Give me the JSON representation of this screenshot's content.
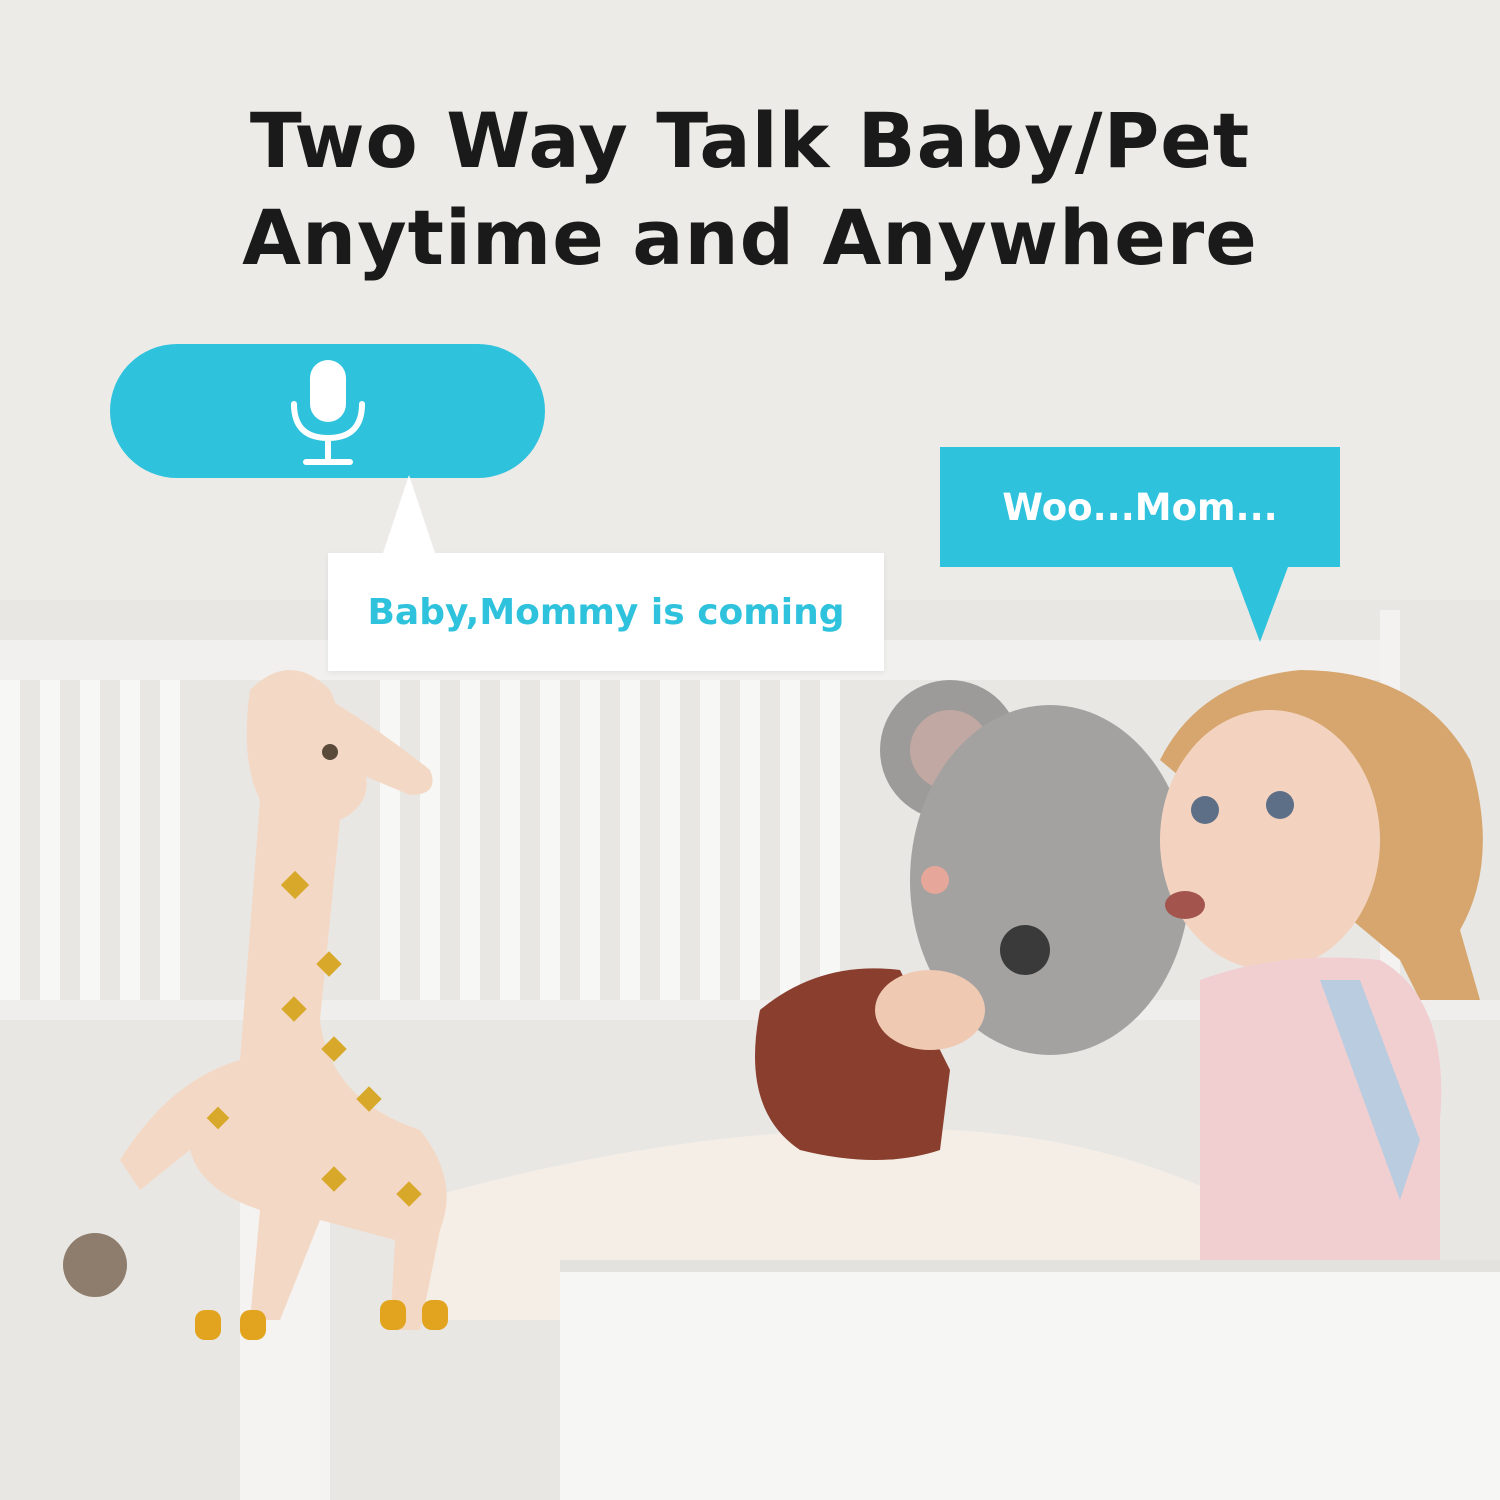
{
  "headline": {
    "line1": "Two Way Talk Baby/Pet",
    "line2": "Anytime and Anywhere"
  },
  "mic_button": {
    "icon": "microphone-icon"
  },
  "parent_bubble": {
    "text": "Baby,Mommy is coming"
  },
  "child_bubble": {
    "text": "Woo...Mom..."
  },
  "colors": {
    "accent": "#2ec2dd",
    "headline": "#1a1a1a",
    "bubble_white": "#ffffff"
  }
}
